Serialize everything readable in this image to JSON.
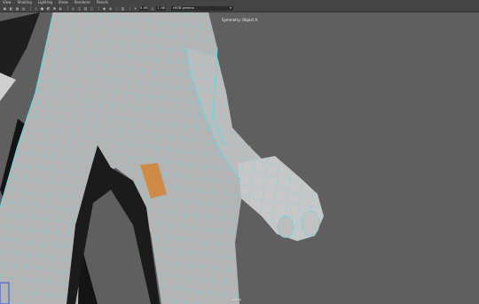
{
  "menu": [
    "View",
    "Shading",
    "Lighting",
    "Show",
    "Renderer",
    "Panels"
  ],
  "toolbar": {
    "icons": [
      "camera-icon",
      "bookmark-icon",
      "grid-icon",
      "film-icon",
      "wireframe-icon",
      "smooth-shade-icon",
      "texture-icon",
      "light-icon",
      "shadow-icon",
      "xray-icon",
      "isolate-icon",
      "grid-toggle-icon",
      "hud-icon",
      "ao-icon",
      "aa-icon",
      "dof-icon",
      "resolution-icon"
    ],
    "exposure": "0.00",
    "gamma": "1.00",
    "color_space": "sRGB gamma"
  },
  "viewport": {
    "symmetry_label": "Symmetry: Object X",
    "camera_label": "persp"
  },
  "colors": {
    "mesh_fill": "#b5b5b5",
    "wire": "#5fd7e8",
    "highlight": "#d08a45"
  }
}
